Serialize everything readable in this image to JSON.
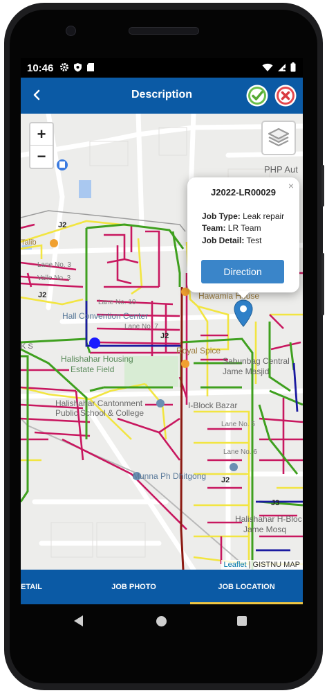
{
  "status_bar": {
    "time": "10:46"
  },
  "app_bar": {
    "title": "Description",
    "back_icon": "chevron-left-icon",
    "confirm_icon": "check-circle-icon",
    "cancel_icon": "close-circle-icon",
    "confirm_color": "#5cb85c",
    "cancel_color": "#e74c4c"
  },
  "map": {
    "zoom_in": "+",
    "zoom_out": "−",
    "labels": {
      "php": "PHP Aut",
      "talib": "Talib",
      "lane3": "Lane No. 3",
      "valle3": "Valle No. 3",
      "lane10": "Lane No. 10",
      "lane7": "Lane No. 7",
      "convention": "Hall Convention Center",
      "hawamia": "Hawamia House",
      "royal": "Royal Spice",
      "sabunbag": "Sabunbag Central",
      "jame": "Jame Masjid",
      "housing": "Halishahar Housing",
      "estate": "Estate Field",
      "cantonment1": "Halishahar Cantonment",
      "cantonment2": "Public School & College",
      "iblock": "I-Block Bazar",
      "lane5": "Lane No. 5",
      "lane6": "Lane No. 6",
      "munna": "Munna Ph Dhitgong",
      "hblock1": "Halishahar H-Bloc",
      "hblock2": "Jame Mosq",
      "ks": "K S",
      "j2a": "J2",
      "j2b": "J2",
      "j2c": "J2",
      "j2d": "J2",
      "j3": "J3"
    },
    "popup": {
      "job_id": "J2022-LR00029",
      "job_type_label": "Job Type:",
      "job_type": "Leak repair",
      "team_label": "Team:",
      "team": "LR Team",
      "job_detail_label": "Job Detail:",
      "job_detail": "Test",
      "direction_label": "Direction",
      "close": "×"
    },
    "attribution_leaflet": "Leaflet",
    "attribution_sep": " | ",
    "attribution_source": "GISTNU MAP"
  },
  "tabs": {
    "detail": "ETAIL",
    "photo": "JOB PHOTO",
    "location": "JOB LOCATION"
  },
  "colors": {
    "primary": "#0b5aa5",
    "tab_indicator": "#f0c642",
    "pipe_magenta": "#c8175f",
    "pipe_green": "#3fa01f",
    "pipe_yellow": "#f2e541",
    "pipe_blue": "#1a1aa0",
    "route_dark": "#555555"
  }
}
